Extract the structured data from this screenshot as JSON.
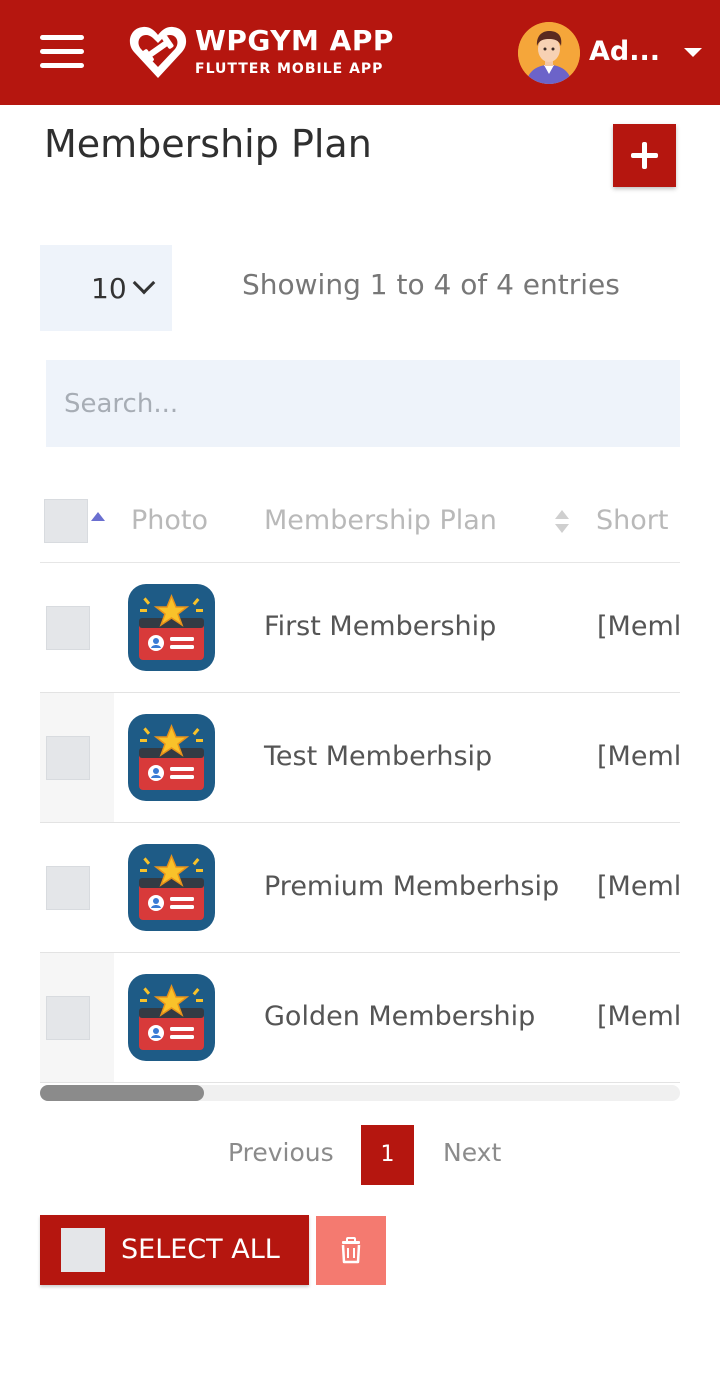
{
  "header": {
    "brand_title": "WPGYM APP",
    "brand_subtitle": "FLUTTER MOBILE APP",
    "user_name": "Ad...",
    "menu_icon": "hamburger-menu-icon",
    "logo_icon": "heart-dumbbell-logo",
    "dropdown_icon": "caret-down-icon",
    "colors": {
      "header_bg": "#b5160f",
      "text": "#ffffff",
      "avatar_bg": "#f5a63a"
    }
  },
  "page": {
    "title": "Membership Plan",
    "add_icon": "plus-icon"
  },
  "table_controls": {
    "page_length": "10",
    "entries_info": "Showing 1 to 4 of 4 entries",
    "search_placeholder": "Search..."
  },
  "table": {
    "columns": [
      "Photo",
      "Membership Plan",
      "Short"
    ],
    "sort": {
      "column": "Photo",
      "direction": "ascending"
    },
    "rows": [
      {
        "plan": "First Membership",
        "short": "[Meml"
      },
      {
        "plan": "Test Memberhsip",
        "short": "[Meml"
      },
      {
        "plan": "Premium Memberhsip",
        "short": "[Meml"
      },
      {
        "plan": "Golden Membership",
        "short": "[Meml"
      }
    ],
    "photo_icon": "membership-card-star-icon"
  },
  "pagination": {
    "previous": "Previous",
    "current": "1",
    "next": "Next"
  },
  "actions": {
    "select_all": "SELECT ALL",
    "delete_icon": "trash-icon"
  },
  "colors": {
    "primary": "#b5160f",
    "delete_bg": "#f47a70",
    "input_bg": "#eef3fa"
  }
}
